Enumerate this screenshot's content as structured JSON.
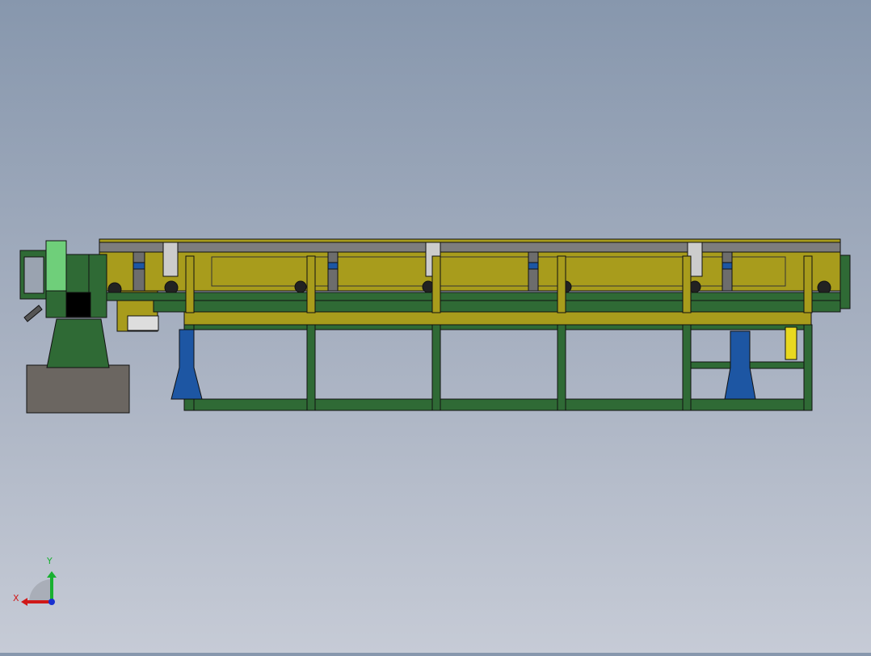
{
  "viewport": {
    "model": "conveyor-machine-front-view",
    "colors": {
      "yellow": "#a89c1c",
      "green": "#2f6a35",
      "light_green": "#6fcf7a",
      "blue": "#1d56a3",
      "gray": "#6b6661",
      "rail_gray": "#7d7d7d"
    }
  },
  "triad": {
    "x_label": "X",
    "y_label": "Y",
    "x_color": "#d01818",
    "y_color": "#18b030",
    "z_color": "#1830d0"
  }
}
